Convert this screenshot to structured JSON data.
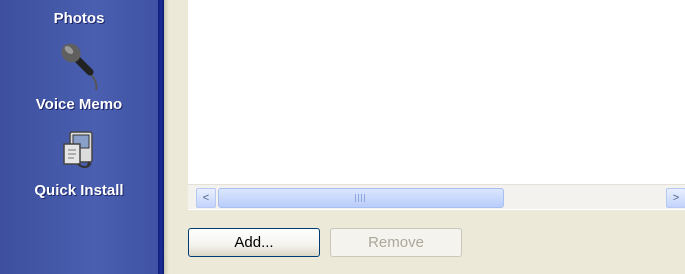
{
  "sidebar": {
    "items": [
      {
        "label": "Photos",
        "icon": "photos-icon"
      },
      {
        "label": "Voice Memo",
        "icon": "microphone-icon"
      },
      {
        "label": "Quick Install",
        "icon": "quick-install-icon"
      }
    ]
  },
  "buttons": {
    "add_label": "Add...",
    "remove_label": "Remove"
  },
  "scrollbar": {
    "left_arrow": "<",
    "right_arrow": ">"
  },
  "colors": {
    "sidebar": "#4a5fb0",
    "sidebar_edge": "#1b2f99",
    "window_bg": "#ece9d8",
    "scroll_thumb": "#b9cdfa"
  }
}
